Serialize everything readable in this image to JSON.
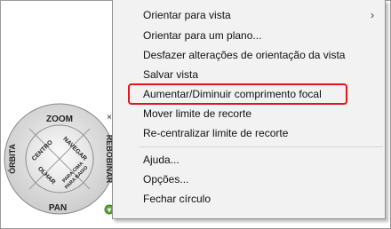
{
  "menu": {
    "items": [
      {
        "label": "Orientar para vista",
        "has_submenu": true,
        "arrow": "›"
      },
      {
        "label": "Orientar para um plano..."
      },
      {
        "label": "Desfazer alterações de orientação da vista"
      },
      {
        "label": "Salvar vista"
      },
      {
        "label": "Aumentar/Diminuir comprimento focal",
        "highlighted": true
      },
      {
        "label": "Mover limite de recorte"
      },
      {
        "label": "Re-centralizar limite de recorte"
      },
      {
        "label": "Ajuda..."
      },
      {
        "label": "Opções..."
      },
      {
        "label": "Fechar círculo"
      }
    ],
    "highlight_color": "#e0161a"
  },
  "wheel": {
    "zoom": "ZOOM",
    "orbita": "ÓRBITA",
    "rebobinar": "REBOBINAR",
    "pan": "PAN",
    "centro": "CENTRO",
    "navegar": "NAVEGAR",
    "olhar": "OLHAR",
    "para_cima_line1": "PARA CIMA",
    "para_cima_line2": "PARA BAIXO",
    "close_glyph": "×",
    "menu_glyph": "▾"
  }
}
